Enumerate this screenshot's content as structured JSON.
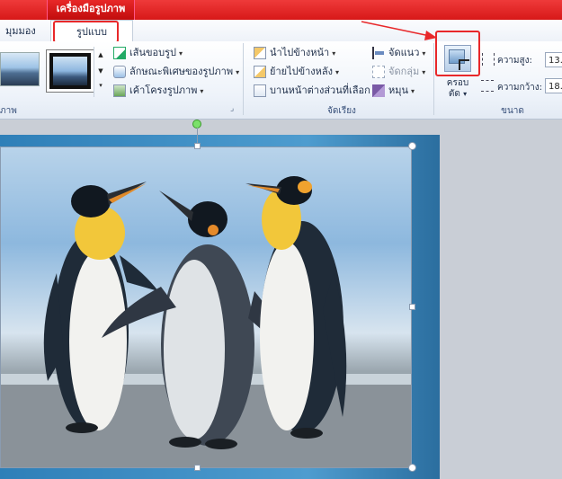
{
  "contextual_tab": {
    "title": "เครื่องมือรูปภาพ"
  },
  "tabs": {
    "view": "มุมมอง",
    "format": "รูปแบบ"
  },
  "ribbon": {
    "picture_styles": {
      "group_label": "ภาพ",
      "border_label": "เส้นขอบรูป",
      "effects_label": "ลักษณะพิเศษของรูปภาพ",
      "layout_label": "เค้าโครงรูปภาพ"
    },
    "arrange": {
      "group_label": "จัดเรียง",
      "bring_forward": "นำไปข้างหน้า",
      "send_backward": "ย้ายไปข้างหลัง",
      "selection_pane": "บานหน้าต่างส่วนที่เลือก",
      "align": "จัดแนว",
      "group": "จัดกลุ่ม",
      "rotate": "หมุน"
    },
    "size": {
      "group_label": "ขนาด",
      "crop_line1": "ครอบ",
      "crop_line2": "ตัด",
      "height_label": "ความสูง:",
      "height_value": "13.",
      "width_label": "ความกว้าง:",
      "width_value": "18."
    }
  },
  "annotation_color": "#e8282a"
}
